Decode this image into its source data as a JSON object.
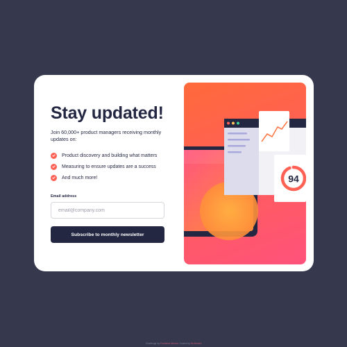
{
  "card": {
    "title": "Stay updated!",
    "intro": "Join 60,000+ product managers receiving monthly updates on:",
    "features": [
      "Product discovery and building what matters",
      "Measuring to ensure updates are a success",
      "And much more!"
    ],
    "email_label": "Email address",
    "email_placeholder": "email@company.com",
    "email_value": "",
    "subscribe_label": "Subscribe to monthly newsletter"
  },
  "illustration": {
    "score": "94"
  },
  "footer": {
    "prefix": "Challenge by ",
    "challenge_link": "Frontend Mentor",
    "middle": ". Coded by ",
    "author_link": "Ali Ahmed"
  },
  "colors": {
    "page_bg": "#36384e",
    "dark_navy": "#242742",
    "tomato": "#ff6155",
    "gradient_start": "#ff6a3a",
    "gradient_end": "#ff527b"
  }
}
